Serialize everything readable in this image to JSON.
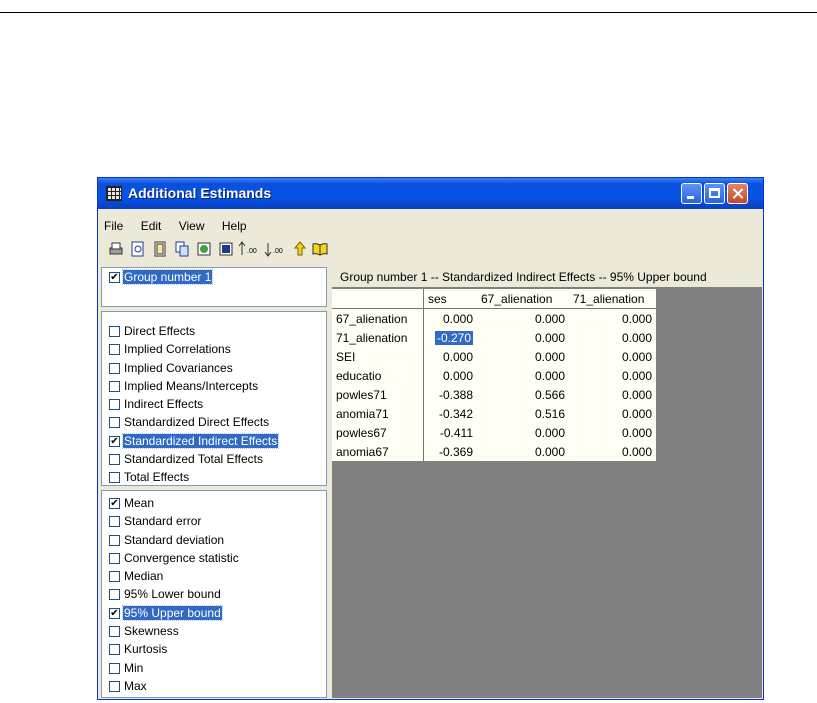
{
  "window": {
    "title": "Additional Estimands"
  },
  "menu": [
    "File",
    "Edit",
    "View",
    "Help"
  ],
  "toolbar_icons": [
    "print-icon",
    "preview-icon",
    "page-setup-icon",
    "copy-icon",
    "refresh-icon",
    "figure-icon",
    "increase-decimals-icon",
    "decrease-decimals-icon",
    "up-arrow-icon",
    "book-icon"
  ],
  "toolbar_glyphs": {
    "increase": ".00",
    "decrease": ".00"
  },
  "groups": [
    {
      "label": "Group number 1",
      "checked": true,
      "selected": true
    }
  ],
  "effects": [
    {
      "label": "Direct Effects",
      "checked": false
    },
    {
      "label": "Implied Correlations",
      "checked": false
    },
    {
      "label": "Implied Covariances",
      "checked": false
    },
    {
      "label": "Implied Means/Intercepts",
      "checked": false
    },
    {
      "label": "Indirect Effects",
      "checked": false
    },
    {
      "label": "Standardized Direct Effects",
      "checked": false
    },
    {
      "label": "Standardized Indirect Effects",
      "checked": true,
      "selected": true
    },
    {
      "label": "Standardized Total Effects",
      "checked": false
    },
    {
      "label": "Total Effects",
      "checked": false
    }
  ],
  "statistics": [
    {
      "label": "Mean",
      "checked": true
    },
    {
      "label": "Standard error",
      "checked": false
    },
    {
      "label": "Standard deviation",
      "checked": false
    },
    {
      "label": "Convergence statistic",
      "checked": false
    },
    {
      "label": "Median",
      "checked": false
    },
    {
      "label": "95% Lower bound",
      "checked": false
    },
    {
      "label": "95% Upper bound",
      "checked": true,
      "selected": true
    },
    {
      "label": "Skewness",
      "checked": false
    },
    {
      "label": "Kurtosis",
      "checked": false
    },
    {
      "label": "Min",
      "checked": false
    },
    {
      "label": "Max",
      "checked": false
    }
  ],
  "table": {
    "title": "Group number 1 -- Standardized Indirect Effects -- 95% Upper bound",
    "columns": [
      "ses",
      "67_alienation",
      "71_alienation"
    ],
    "rows": [
      {
        "name": "67_alienation",
        "values": [
          "0.000",
          "0.000",
          "0.000"
        ]
      },
      {
        "name": "71_alienation",
        "values": [
          "-0.270",
          "0.000",
          "0.000"
        ],
        "highlight": 0
      },
      {
        "name": "SEI",
        "values": [
          "0.000",
          "0.000",
          "0.000"
        ]
      },
      {
        "name": "educatio",
        "values": [
          "0.000",
          "0.000",
          "0.000"
        ]
      },
      {
        "name": "powles71",
        "values": [
          "-0.388",
          "0.566",
          "0.000"
        ]
      },
      {
        "name": "anomia71",
        "values": [
          "-0.342",
          "0.516",
          "0.000"
        ]
      },
      {
        "name": "powles67",
        "values": [
          "-0.411",
          "0.000",
          "0.000"
        ]
      },
      {
        "name": "anomia67",
        "values": [
          "-0.369",
          "0.000",
          "0.000"
        ]
      }
    ]
  },
  "colors": {
    "titlebar": "#0454e8",
    "selection": "#316ac5",
    "grid_background": "#808080",
    "cell_background": "#fffff5"
  }
}
